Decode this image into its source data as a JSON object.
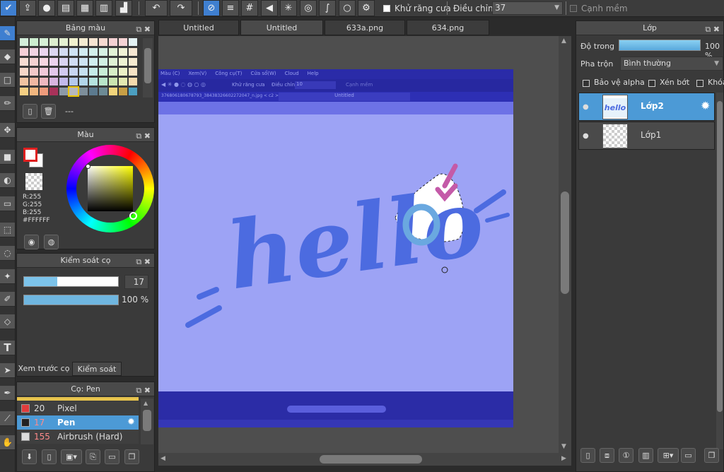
{
  "toolbar": {
    "antialias_label": "Khử răng cưa",
    "adjust_label": "Điều chỉnh",
    "adjust_value": "37",
    "soft_edge_label": "Cạnh mềm"
  },
  "tabs": [
    {
      "label": "Untitled"
    },
    {
      "label": "Untitled"
    },
    {
      "label": "633a.png"
    },
    {
      "label": "634.png"
    }
  ],
  "palette_panel": {
    "title": "Bảng màu",
    "value": "---",
    "colors": [
      "#d3edda",
      "#cdeed0",
      "#d6f0d6",
      "#ddeecf",
      "#e4f1d2",
      "#f1f2cf",
      "#f4ecd2",
      "#f6e4d2",
      "#f5d9d0",
      "#f4d1d3",
      "#f6d3d4",
      "#e4f2f4",
      "#f5cfd7",
      "#f2d4e3",
      "#ead4ee",
      "#dcd6f1",
      "#d3dcf2",
      "#cfe3f4",
      "#d1ecf2",
      "#d3f0ec",
      "#d6f1e4",
      "#e2f2d6",
      "#f1f2d5",
      "#f6e7d2",
      "#f6dcd2",
      "#f4d2d2",
      "#f6d6e1",
      "#ecd3ee",
      "#dad4f2",
      "#d1ddf3",
      "#cee4f3",
      "#d0eef0",
      "#d2f0e4",
      "#dff1d5",
      "#eef2d3",
      "#f6ead0",
      "#f5d7c8",
      "#f2c9c9",
      "#f1c9d9",
      "#e3c8eb",
      "#d2caf0",
      "#c8d6f1",
      "#c6e1f1",
      "#c6ecea",
      "#c9edd7",
      "#d7edc7",
      "#ecf0c6",
      "#f6e2c4",
      "#f0c4a1",
      "#f0b8a2",
      "#eeb8c0",
      "#d8b5e0",
      "#c2b9eb",
      "#b4c8ec",
      "#b2d6eb",
      "#b5e3df",
      "#b8e5c9",
      "#cbe4b0",
      "#e4e9b1",
      "#f5d9ac",
      "#f5cf83",
      "#f2b77f",
      "#ee9b7b",
      "#a8325a",
      "#8d9aa8",
      "#b6b8bd",
      "#7d8e9a",
      "#5c7a8f",
      "#6d8b95",
      "#f2d47a",
      "#c79f45",
      "#4b9fc1"
    ],
    "selected_index": 65
  },
  "color_panel": {
    "title": "Màu",
    "r": "R:255",
    "g": "G:255",
    "b": "B:255",
    "hex": "#FFFFFF"
  },
  "brush_control": {
    "title": "Kiểm soát cọ",
    "size_value": "17",
    "opacity_value": "100 %",
    "size_fraction": 0.35,
    "opacity_fraction": 1.0,
    "tab_preview": "Xem trước cọ",
    "tab_control": "Kiểm soát cọ"
  },
  "brush_list": {
    "title": "Cọ: Pen",
    "items": [
      {
        "size": "20",
        "name": "Pixel",
        "color": "#e03c3c"
      },
      {
        "size": "17",
        "name": "Pen",
        "color": "#222222"
      },
      {
        "size": "155",
        "name": "Airbrush (Hard)",
        "color": "#dddddd"
      }
    ]
  },
  "inner_app": {
    "menu": [
      "Màu (C)",
      "Xem(V)",
      "Công cụ(T)",
      "Cửa sổ(W)",
      "Cloud",
      "Help"
    ],
    "antialias": "Khử răng cưa",
    "adjust": "Điều chỉnh",
    "adjust_value": "10",
    "soft": "Cạnh mềm",
    "filename": "376806180678793_38438326602272047_n.jpg < c2 >",
    "tab": "Untitled"
  },
  "canvas_text": "hello",
  "layer_panel": {
    "title": "Lớp",
    "opacity_label": "Độ trong",
    "opacity_value": "100 %",
    "opacity_fraction": 1.0,
    "blend_label": "Pha trộn",
    "blend_value": "Bình thường",
    "protect_alpha": "Bảo vệ alpha",
    "clip": "Xén bớt",
    "lock": "Khóa",
    "layers": [
      {
        "name": "Lớp2"
      },
      {
        "name": "Lớp1"
      }
    ]
  }
}
